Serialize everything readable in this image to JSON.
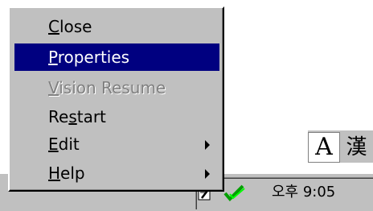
{
  "menu": {
    "items": [
      {
        "pre": "",
        "mn": "C",
        "post": "lose",
        "state": "normal",
        "submenu": false
      },
      {
        "pre": "",
        "mn": "P",
        "post": "roperties",
        "state": "selected",
        "submenu": false
      },
      {
        "pre": "",
        "mn": "V",
        "post": "ision Resume",
        "state": "disabled",
        "submenu": false
      },
      {
        "pre": "Re",
        "mn": "s",
        "post": "tart",
        "state": "normal",
        "submenu": false
      },
      {
        "pre": "",
        "mn": "E",
        "post": "dit",
        "state": "normal",
        "submenu": true
      },
      {
        "pre": "",
        "mn": "H",
        "post": "elp",
        "state": "normal",
        "submenu": true
      }
    ]
  },
  "ime": {
    "mode_label": "A",
    "hanja_label": "漢"
  },
  "taskbar": {
    "clock": "오후 9:05",
    "tray_icons": [
      "app-tray-icon",
      "checkmark-tray-icon"
    ]
  },
  "colors": {
    "menu_bg": "#c0c0c0",
    "highlight": "#000080",
    "disabled": "#808080"
  }
}
